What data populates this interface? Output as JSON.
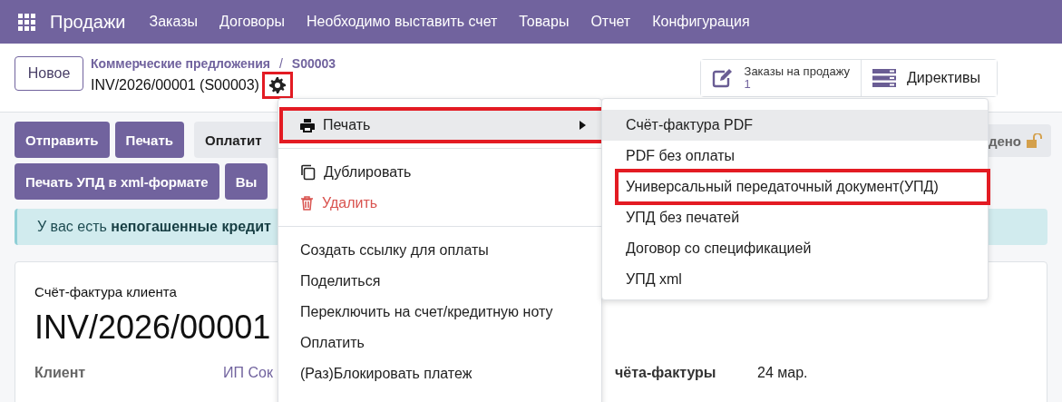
{
  "navbar": {
    "app_title": "Продажи",
    "menu": [
      "Заказы",
      "Договоры",
      "Необходимо выставить счет",
      "Товары",
      "Отчет",
      "Конфигурация"
    ]
  },
  "control_panel": {
    "new_button": "Новое",
    "breadcrumbs": [
      "Коммерческие предложения",
      "/",
      "S00003"
    ],
    "record_title": "INV/2026/00001 (S00003)",
    "gear_annotated": true,
    "smart_buttons": [
      {
        "kind": "orders",
        "label": "Заказы на продажу",
        "value": "1"
      },
      {
        "kind": "directives",
        "label": "Директивы"
      }
    ]
  },
  "action_rows": [
    [
      {
        "label": "Отправить",
        "kind": "primary"
      },
      {
        "label": "Печать",
        "kind": "primary"
      },
      {
        "label": "Оплатит",
        "kind": "secondary"
      }
    ],
    [
      {
        "label": "Печать УПД в xml-формате",
        "kind": "primary"
      },
      {
        "label": "Вы",
        "kind": "primary"
      }
    ]
  ],
  "status": {
    "label": "дено",
    "locked": false
  },
  "alert": {
    "text": "У вас есть **непогашенные кредит**"
  },
  "card": {
    "subtitle": "Счёт-фактура клиента",
    "title": "INV/2026/00001",
    "fields": [
      {
        "label": "Клиент",
        "value": "ИП Сок"
      },
      {
        "label": "чёта-фактуры",
        "value": "24 мар."
      }
    ]
  },
  "actions_menu": {
    "sections": [
      [
        {
          "kind": "submenu",
          "label": "Печать",
          "selected": true,
          "annotated": true
        }
      ],
      [
        {
          "kind": "duplicate",
          "label": "Дублировать",
          "selected": false,
          "annotated": false
        },
        {
          "kind": "delete",
          "label": "Удалить",
          "selected": false,
          "annotated": false
        }
      ],
      [
        {
          "kind": "plain",
          "label": "Создать ссылку для оплаты",
          "selected": false,
          "annotated": false
        },
        {
          "kind": "plain",
          "label": "Поделиться",
          "selected": false,
          "annotated": false
        },
        {
          "kind": "plain",
          "label": "Переключить на счет/кредитную ноту",
          "selected": false,
          "annotated": false
        },
        {
          "kind": "plain",
          "label": "Оплатить",
          "selected": false,
          "annotated": false
        },
        {
          "kind": "plain",
          "label": "(Раз)Блокировать платеж",
          "selected": false,
          "annotated": false
        }
      ]
    ]
  },
  "print_submenu": {
    "items": [
      {
        "label": "Счёт-фактура PDF",
        "selected": true,
        "annotated": false
      },
      {
        "label": "PDF без оплаты",
        "selected": false,
        "annotated": false
      },
      {
        "label": "Универсальный передаточный документ(УПД)",
        "selected": false,
        "annotated": true
      },
      {
        "label": "УПД без печатей",
        "selected": false,
        "annotated": false
      },
      {
        "label": "Договор со спецификацией",
        "selected": false,
        "annotated": false
      },
      {
        "label": "УПД xml",
        "selected": false,
        "annotated": false
      }
    ]
  }
}
